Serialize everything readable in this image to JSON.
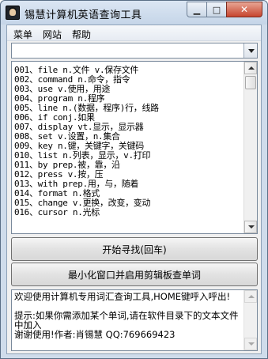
{
  "window": {
    "title": "锡慧计算机英语查询工具",
    "icon": "portrait-icon",
    "controls": {
      "minimize": "▁",
      "maximize": "□",
      "close": "✕"
    }
  },
  "menubar": {
    "items": [
      {
        "label": "菜单"
      },
      {
        "label": "网站"
      },
      {
        "label": "帮助"
      }
    ]
  },
  "search_combo": {
    "value": ""
  },
  "word_list": {
    "items": [
      "001、file  n.文件  v.保存文件",
      "002、command  n.命令，指令",
      "003、use  v.使用，用途",
      "004、program  n.程序",
      "005、line  n.(数据，程序)行，线路",
      "006、if  conj.如果",
      "007、display    vt.显示，显示器",
      "008、set  v.设置，n.集合",
      "009、key  n.键，关键字，关键码",
      "010、list  n.列表，显示，v.打印",
      "011、by  prep.被，靠，沿",
      "012、press  v.按，压",
      "013、with  prep.用，与，随着",
      "014、format  n.格式",
      "015、change  v.更换，改变，变动",
      "016、cursor  n.光标"
    ]
  },
  "buttons": {
    "search": "开始寻找(回车)",
    "clipboard": "最小化窗口并启用剪辑板查单词"
  },
  "info_memo": {
    "lines": [
      "欢迎使用计算机专用词汇查询工具,HOME键呼入呼出!",
      "",
      "提示:如果你需添加某个单词,请在软件目录下的文本文件中加入",
      "谢谢使用!作者:肖锡慧 QQ:769669423"
    ]
  },
  "colors": {
    "title_bar": "#c5d5e8",
    "close_button": "#c7452e",
    "client_bg": "#f0f0f0"
  }
}
